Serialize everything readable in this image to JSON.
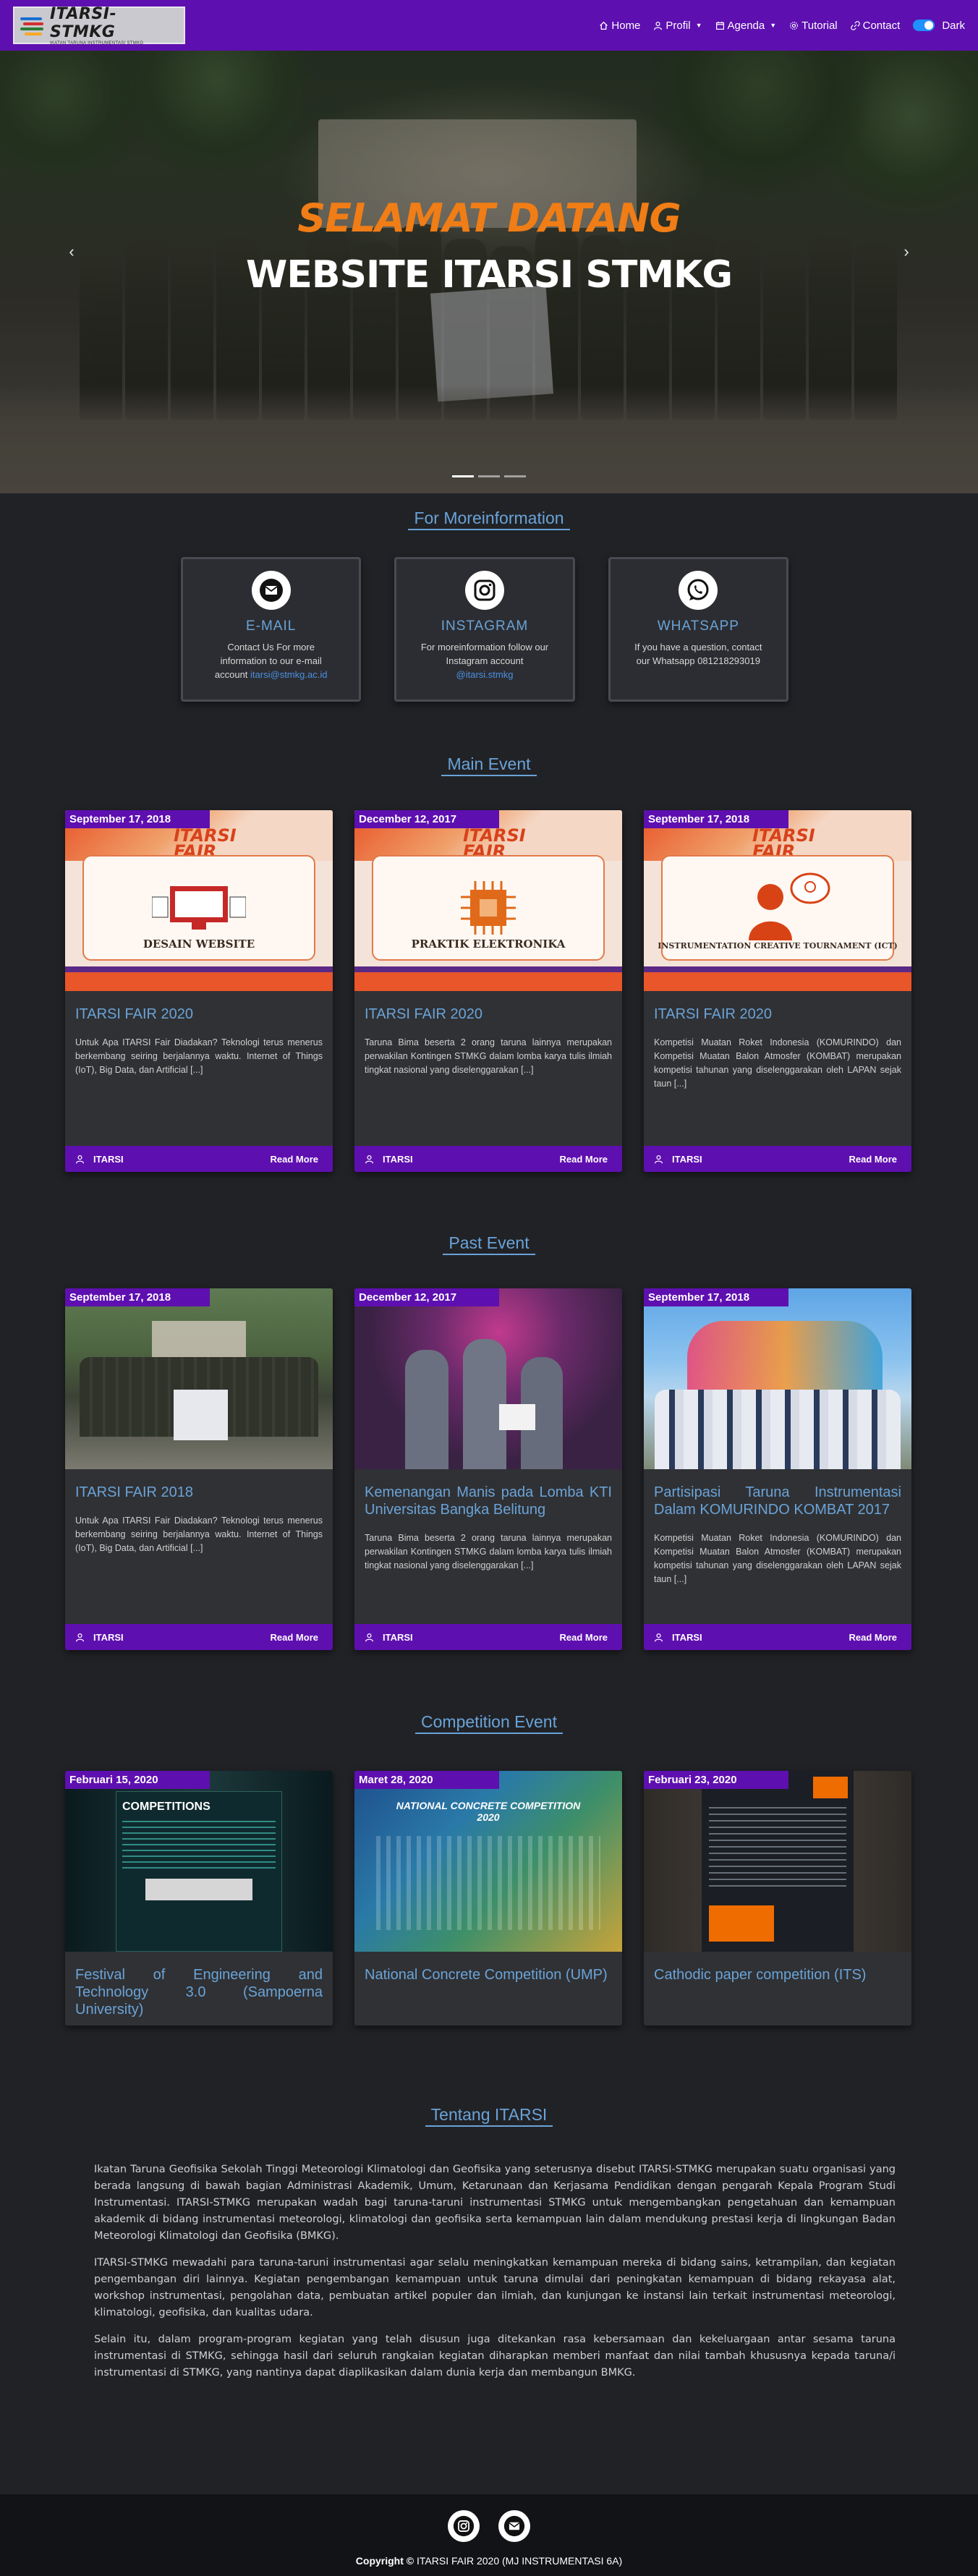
{
  "nav": {
    "logo_title": "ITARSI-STMKG",
    "logo_sub": "IKATAN TARUNA INSTRUMENTASI STMKG",
    "items": [
      {
        "label": "Home",
        "icon": "home-icon",
        "caret": false
      },
      {
        "label": "Profil",
        "icon": "user-icon",
        "caret": true
      },
      {
        "label": "Agenda",
        "icon": "calendar-icon",
        "caret": true
      },
      {
        "label": "Tutorial",
        "icon": "gear-icon",
        "caret": false
      },
      {
        "label": "Contact",
        "icon": "link-icon",
        "caret": false
      }
    ],
    "theme_label": "Dark"
  },
  "hero": {
    "line1": "SELAMAT DATANG",
    "line2": "WEBSITE ITARSI STMKG",
    "prev": "‹",
    "next": "›"
  },
  "contact": {
    "title": "For Moreinformation",
    "cards": [
      {
        "icon": "mail-icon",
        "title": "E-MAIL",
        "text": "Contact Us For more information to our e-mail account ",
        "link": "itarsi@stmkg.ac.id"
      },
      {
        "icon": "instagram-icon",
        "title": "INSTAGRAM",
        "text": "For moreinformation follow our Instagram account ",
        "link": "@itarsi.stmkg"
      },
      {
        "icon": "whatsapp-icon",
        "title": "WHATSAPP",
        "text": "If you have a question, contact our Whatsapp 081218293019",
        "link": ""
      }
    ]
  },
  "main_event": {
    "title": "Main Event",
    "cards": [
      {
        "date": "September 17, 2018",
        "poster_label": "DESAIN WEBSITE",
        "title": "ITARSI FAIR 2020",
        "desc": "Untuk Apa ITARSI Fair Diadakan? Teknologi terus menerus berkembang seiring berjalannya waktu. Internet of Things (IoT), Big Data, dan Artificial [...]",
        "author": "ITARSI",
        "read": "Read More"
      },
      {
        "date": "December 12, 2017",
        "poster_label": "PRAKTIK ELEKTRONIKA",
        "title": "ITARSI FAIR 2020",
        "desc": "Taruna Bima beserta 2 orang taruna lainnya merupakan perwakilan Kontingen STMKG dalam lomba karya tulis ilmiah tingkat nasional yang diselenggarakan [...]",
        "author": "ITARSI",
        "read": "Read More"
      },
      {
        "date": "September 17, 2018",
        "poster_label": "INSTRUMENTATION CREATIVE TOURNAMENT (ICT)",
        "title": "ITARSI FAIR 2020",
        "desc": "Kompetisi Muatan Roket Indonesia (KOMURINDO) dan Kompetisi Muatan Balon Atmosfer (KOMBAT) merupakan kompetisi tahunan yang diselenggarakan oleh LAPAN sejak taun [...]",
        "author": "ITARSI",
        "read": "Read More"
      }
    ]
  },
  "past_event": {
    "title": "Past Event",
    "cards": [
      {
        "date": "September 17, 2018",
        "title": "ITARSI FAIR 2018",
        "desc": "Untuk Apa ITARSI Fair Diadakan? Teknologi terus menerus berkembang seiring berjalannya waktu. Internet of Things (IoT), Big Data, dan Artificial [...]",
        "author": "ITARSI",
        "read": "Read More"
      },
      {
        "date": "December 12, 2017",
        "title": "Kemenangan Manis pada Lomba KTI Universitas Bangka Belitung",
        "desc": "Taruna Bima beserta 2 orang taruna lainnya merupakan perwakilan Kontingen STMKG dalam lomba karya tulis ilmiah tingkat nasional yang diselenggarakan [...]",
        "author": "ITARSI",
        "read": "Read More"
      },
      {
        "date": "September 17, 2018",
        "title": "Partisipasi Taruna Instrumentasi Dalam KOMURINDO KOMBAT 2017",
        "desc": "Kompetisi Muatan Roket Indonesia (KOMURINDO) dan Kompetisi Muatan Balon Atmosfer (KOMBAT) merupakan kompetisi tahunan yang diselenggarakan oleh LAPAN sejak taun [...]",
        "author": "ITARSI",
        "read": "Read More"
      }
    ]
  },
  "competition": {
    "title": "Competition Event",
    "cards": [
      {
        "date": "Februari 15, 2020",
        "poster_label": "COMPETITIONS",
        "title": "Festival of Engineering and Technology 3.0 (Sampoerna University)"
      },
      {
        "date": "Maret 28, 2020",
        "poster_label": "NATIONAL CONCRETE COMPETITION 2020",
        "title": "National Concrete Competition (UMP)"
      },
      {
        "date": "Februari 23, 2020",
        "poster_label": "",
        "title": "Cathodic paper competition (ITS)"
      }
    ]
  },
  "about": {
    "title": "Tentang ITARSI",
    "paragraphs": [
      "Ikatan Taruna Geofisika Sekolah Tinggi Meteorologi Klimatologi dan Geofisika yang seterusnya disebut ITARSI-STMKG merupakan suatu organisasi yang berada langsung di bawah bagian Administrasi Akademik, Umum, Ketarunaan dan Kerjasama Pendidikan dengan pengarah Kepala Program Studi Instrumentasi. ITARSI-STMKG merupakan wadah bagi taruna-taruni instrumentasi STMKG untuk mengembangkan pengetahuan dan kemampuan akademik di bidang instrumentasi meteorologi, klimatologi dan geofisika serta kemampuan lain dalam mendukung prestasi kerja di lingkungan Badan Meteorologi Klimatologi dan Geofisika (BMKG).",
      "ITARSI-STMKG mewadahi para taruna-taruni instrumentasi agar selalu meningkatkan kemampuan mereka di bidang sains, ketrampilan, dan kegiatan pengembangan diri lainnya. Kegiatan pengembangan kemampuan untuk taruna dimulai dari peningkatan kemampuan di bidang rekayasa alat, workshop instrumentasi, pengolahan data, pembuatan artikel populer dan ilmiah, dan kunjungan ke instansi lain terkait instrumentasi meteorologi, klimatologi, geofisika, dan kualitas udara.",
      "Selain itu, dalam program-program kegiatan yang telah disusun juga ditekankan rasa kebersamaan dan kekeluargaan antar sesama taruna instrumentasi di STMKG, sehingga hasil dari seluruh rangkaian kegiatan diharapkan memberi manfaat dan nilai tambah khususnya kepada taruna/i instrumentasi di STMKG, yang nantinya dapat diaplikasikan dalam dunia kerja dan membangun BMKG."
    ]
  },
  "footer": {
    "copyright_label": "Copyright ©",
    "copyright_text": " ITARSI FAIR 2020 (MJ INSTRUMENTASI 6A)"
  },
  "colors": {
    "accent": "#5e0fb0",
    "title_blue": "#6aa3d8",
    "hero_orange": "#f07d16",
    "bg": "#212226"
  }
}
